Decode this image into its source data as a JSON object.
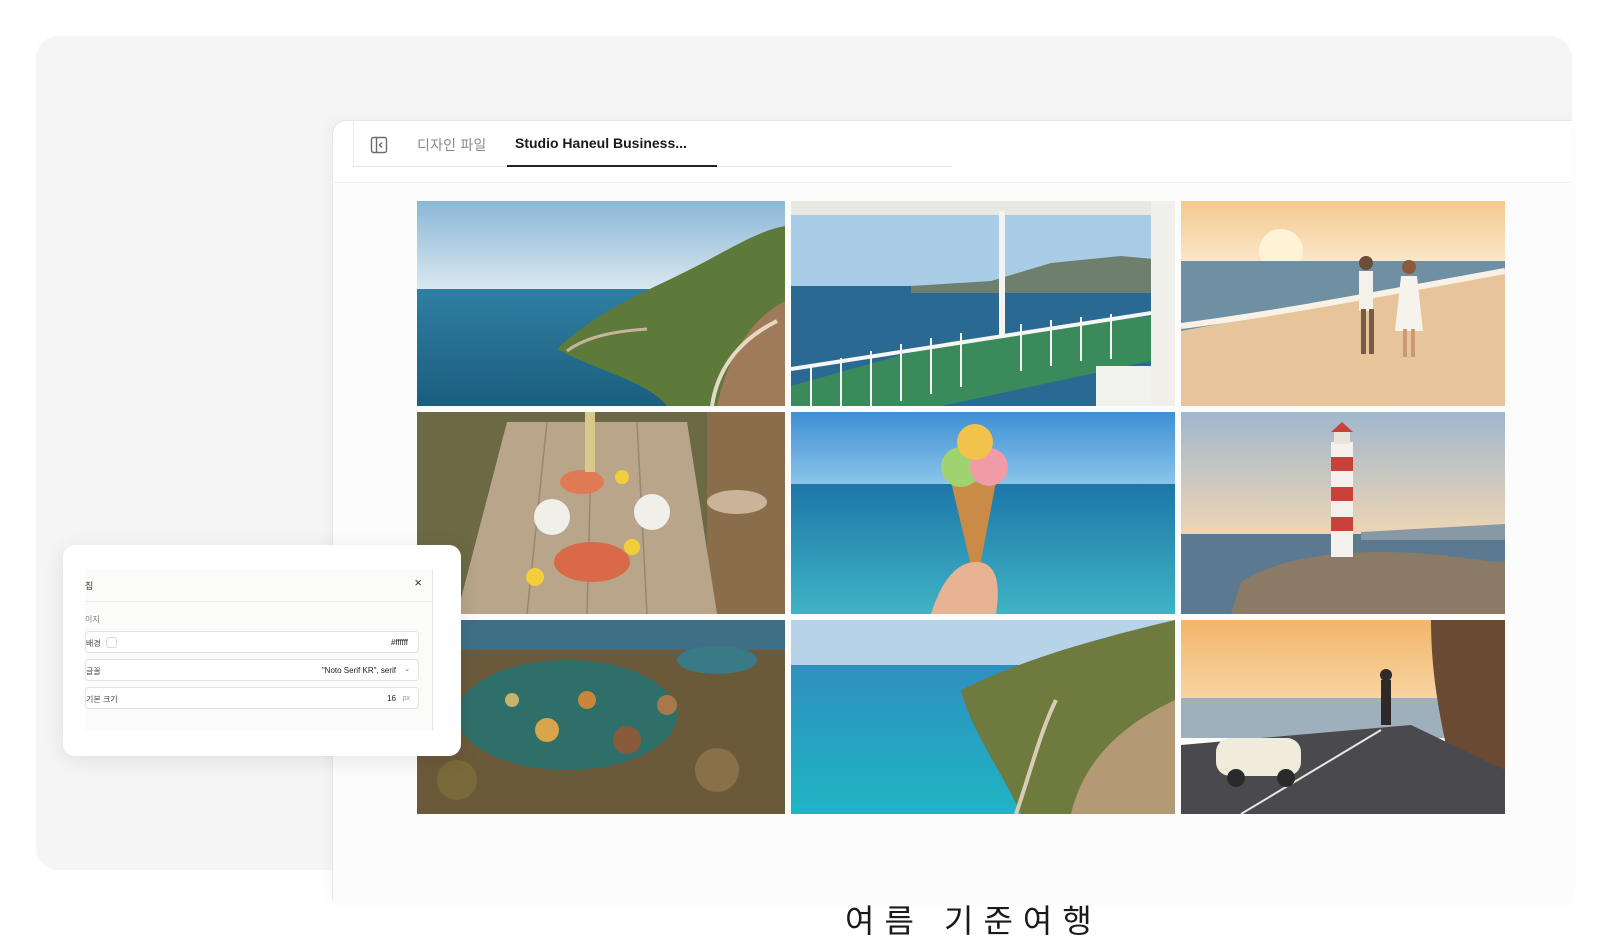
{
  "tabs": {
    "design_file": "디자인 파일",
    "active": "Studio Haneul Business..."
  },
  "photos": [
    {
      "name": "coastal-cliff-road-photo"
    },
    {
      "name": "ferry-deck-photo"
    },
    {
      "name": "beach-couple-sunset-photo"
    },
    {
      "name": "seafood-table-photo"
    },
    {
      "name": "ice-cream-cone-photo"
    },
    {
      "name": "lighthouse-photo"
    },
    {
      "name": "tide-pool-photo"
    },
    {
      "name": "turquoise-bay-road-photo"
    },
    {
      "name": "vintage-car-sunset-photo"
    }
  ],
  "heading_peek": "여름 기준여행",
  "panel": {
    "title": "집",
    "section": "이지",
    "background_label": "배경",
    "background_value": "#ffffff",
    "font_label": "글꼴",
    "font_value": "\"Noto Serif KR\", serif",
    "size_label": "기본 크기",
    "size_value": "16",
    "size_unit": "px",
    "close": "×"
  }
}
